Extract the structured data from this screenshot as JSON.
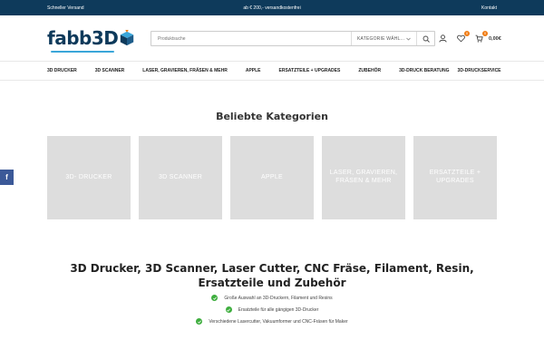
{
  "topbar": {
    "left": "Schneller Versand",
    "center": "ab € 200,- versandkostenfrei",
    "right": "Kontakt"
  },
  "logo": {
    "text": "fabb3D"
  },
  "search": {
    "placeholder": "Produktsuche",
    "category": "KATEGORIE WÄHL..."
  },
  "header_icons": {
    "wishlist_count": "0",
    "cart_count": "0",
    "cart_total": "0,00€"
  },
  "nav": {
    "items": [
      "3D DRUCKER",
      "3D SCANNER",
      "LASER, GRAVIEREN, FRÄSEN & MEHR",
      "APPLE",
      "ERSATZTEILE + UPGRADES",
      "ZUBEHÖR"
    ],
    "right_items": [
      "3D-DRUCK BERATUNG",
      "3D-DRUCKSERVICE"
    ]
  },
  "categories": {
    "title": "Beliebte Kategorien",
    "cards": [
      "3D- DRUCKER",
      "3D SCANNER",
      "APPLE",
      "LASER, GRAVIEREN, FRÄSEN & MEHR",
      "ERSATZTEILE + UPGRADES"
    ]
  },
  "social": {
    "facebook": "f"
  },
  "intro": {
    "headline": "3D Drucker, 3D Scanner, Laser Cutter, CNC Fräse, Filament, Resin, Ersatzteile und Zubehör",
    "bullets": [
      "Große Auswahl an 3D-Druckern, Filament und Resins",
      "Ersatzteile für alle gängigen 3D-Drucker",
      "Verschiedene Lasercutter, Vakuumformer und CNC-Fräsen für Maker"
    ]
  },
  "colors": {
    "brand": "#0e3a5b",
    "accent": "#f07c14",
    "check": "#3fae3f"
  }
}
